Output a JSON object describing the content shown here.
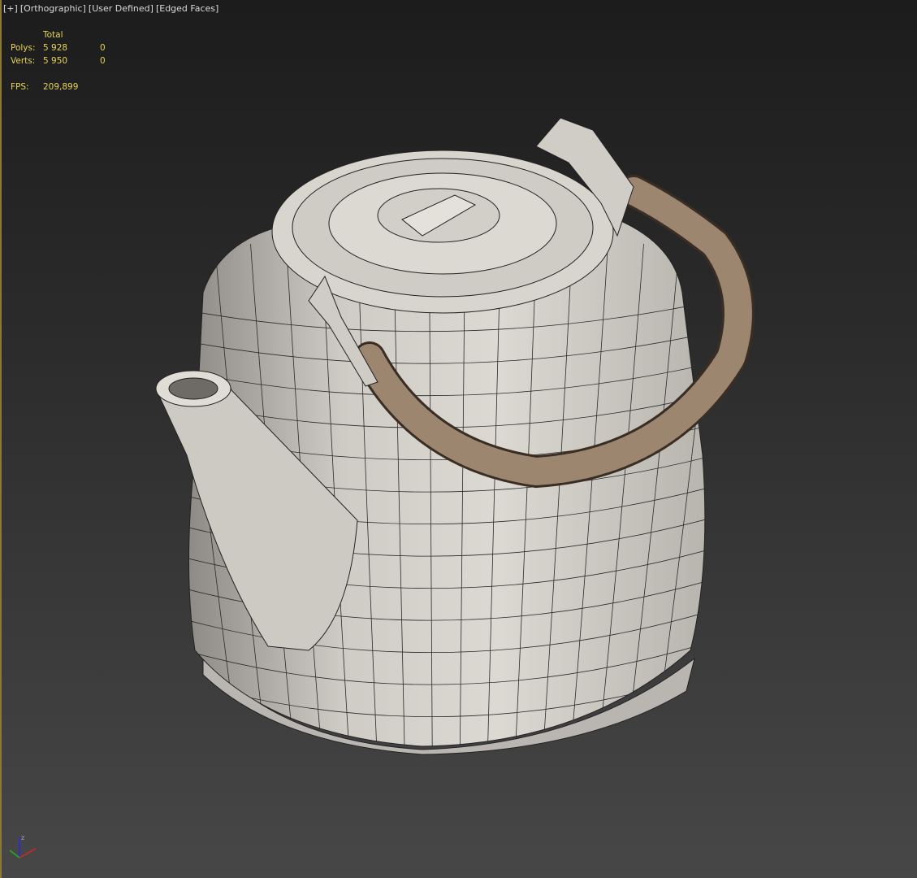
{
  "viewport": {
    "labels": [
      "[+]",
      "[Orthographic]",
      "[User Defined]",
      "[Edged Faces]"
    ],
    "active_border_color": "#8a7a3a"
  },
  "stats": {
    "header": "Total",
    "polys_label": "Polys:",
    "polys_total": "5 928",
    "polys_selected": "0",
    "verts_label": "Verts:",
    "verts_total": "5 950",
    "verts_selected": "0",
    "fps_label": "FPS:",
    "fps_value": "209,899",
    "text_color": "#e6d25a"
  },
  "scene": {
    "object": "teapot",
    "body_color": "#d6d2cc",
    "handle_color": "#9c8670",
    "wire_color": "#202020"
  },
  "gizmo": {
    "axes": [
      "x",
      "y",
      "z"
    ],
    "colors": {
      "x": "#b03030",
      "y": "#2f9a2f",
      "z": "#3030c0"
    },
    "z_label": "z"
  }
}
